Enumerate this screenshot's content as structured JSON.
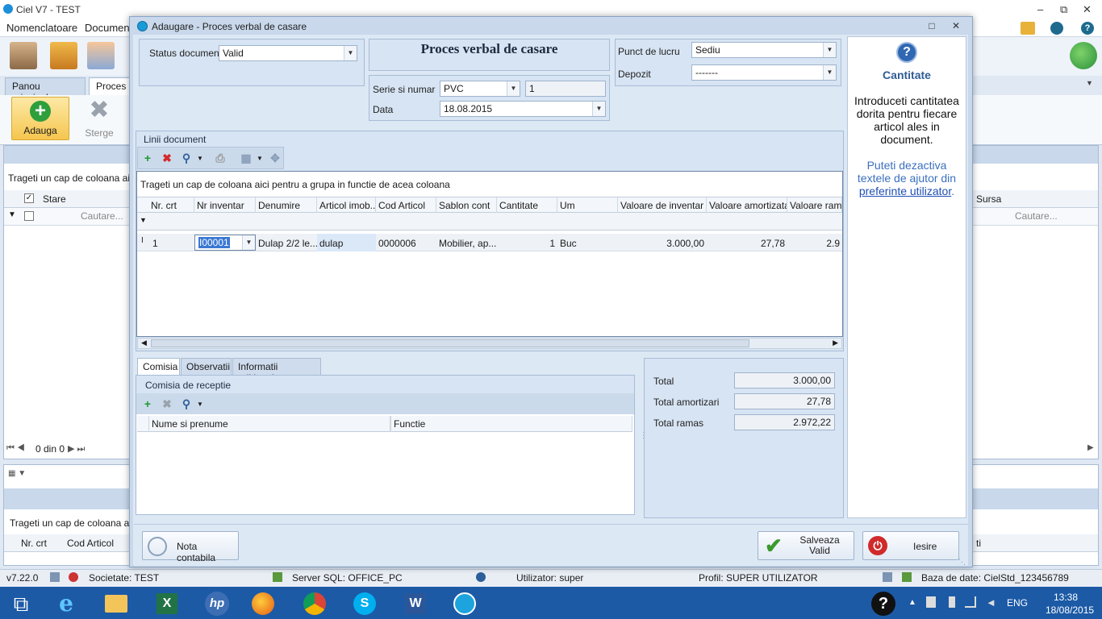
{
  "app": {
    "title": "Ciel V7 - TEST",
    "menu": [
      "Nomenclatoare",
      "Documen"
    ],
    "tabs": [
      "Panou principal",
      "Proces v"
    ],
    "ribbon": {
      "add_label": "Adauga",
      "delete_label": "Sterge"
    },
    "bg_grid": {
      "group_hint": "Trageti un cap de coloana aici p",
      "col_stare": "Stare",
      "search_placeholder": "Cautare...",
      "col_sursa": "Sursa",
      "search_placeholder_right": "Cautare...",
      "pager": "0 din 0"
    },
    "bg_grid2": {
      "group_hint": "Trageti un cap de coloana aici",
      "col_nr": "Nr. crt",
      "col_cod": "Cod Articol",
      "col_right": "ti"
    },
    "status": {
      "version": "v7.22.0",
      "company": "Societate: TEST",
      "server": "Server SQL: OFFICE_PC",
      "user": "Utilizator: super",
      "profile": "Profil: SUPER UTILIZATOR",
      "database": "Baza de date: CielStd_123456789"
    }
  },
  "taskbar": {
    "lang": "ENG",
    "time": "13:38",
    "date": "18/08/2015",
    "apps": [
      "start-icon",
      "internet-explorer-icon",
      "file-explorer-icon",
      "excel-icon",
      "hp-icon",
      "firefox-icon",
      "chrome-icon",
      "skype-icon",
      "word-icon",
      "ciel-icon"
    ]
  },
  "dialog": {
    "title": "Adaugare - Proces verbal de casare",
    "heading": "Proces verbal de casare",
    "status_label": "Status document",
    "status_value": "Valid",
    "serie_label": "Serie si numar",
    "serie_value": "PVC",
    "numar_value": "1",
    "data_label": "Data",
    "data_value": "18.08.2015",
    "punct_label": "Punct de lucru",
    "punct_value": "Sediu",
    "depozit_label": "Depozit",
    "depozit_value": "-------",
    "lines_group": "Linii document",
    "group_hint": "Trageti un cap de coloana aici pentru a grupa in functie de acea coloana",
    "columns": [
      "Nr. crt",
      "Nr inventar",
      "Denumire",
      "Articol imob...",
      "Cod Articol",
      "Sablon cont",
      "Cantitate",
      "Um",
      "Valoare de inventar",
      "Valoare amortizata",
      "Valoare ramas"
    ],
    "rows": [
      [
        "1",
        "I00001",
        "Dulap 2/2 le...",
        "dulap",
        "0000006",
        "Mobilier, ap...",
        "1",
        "Buc",
        "3.000,00",
        "27,78",
        "2.9"
      ]
    ],
    "bottom_tabs": [
      "Comisia",
      "Observatii",
      "Informatii aditionale"
    ],
    "comisia_group": "Comisia de receptie",
    "comisia_columns": [
      "Nume si prenume",
      "Functie"
    ],
    "totals": [
      {
        "label": "Total",
        "value": "3.000,00"
      },
      {
        "label": "Total amortizari",
        "value": "27,78"
      },
      {
        "label": "Total ramas",
        "value": "2.972,22"
      }
    ],
    "btn_nota": "Nota contabila",
    "btn_save": "Salveaza\nValid",
    "btn_save_l1": "Salveaza",
    "btn_save_l2": "Valid",
    "btn_exit": "Iesire",
    "help": {
      "title": "Cantitate",
      "text": "Introduceti cantitatea dorita pentru fiecare articol ales in document.",
      "text2": "Puteti dezactiva textele de ajutor din",
      "link": "preferinte utilizator",
      "dot": "."
    }
  }
}
